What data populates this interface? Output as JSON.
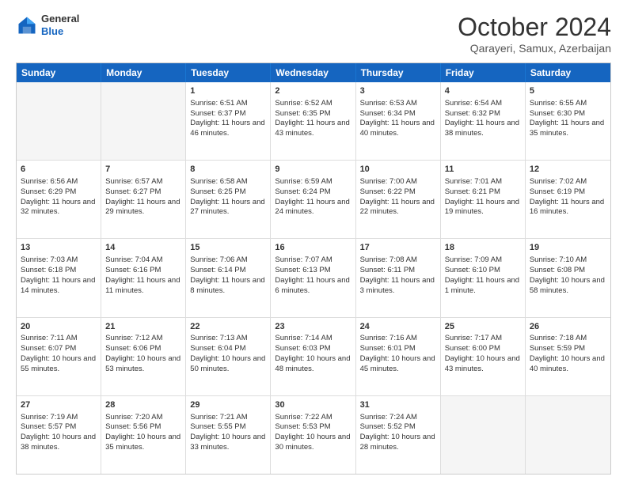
{
  "header": {
    "logo_general": "General",
    "logo_blue": "Blue",
    "month_title": "October 2024",
    "subtitle": "Qarayeri, Samux, Azerbaijan"
  },
  "weekdays": [
    "Sunday",
    "Monday",
    "Tuesday",
    "Wednesday",
    "Thursday",
    "Friday",
    "Saturday"
  ],
  "rows": [
    [
      {
        "day": "",
        "empty": true
      },
      {
        "day": "",
        "empty": true
      },
      {
        "day": "1",
        "sunrise": "Sunrise: 6:51 AM",
        "sunset": "Sunset: 6:37 PM",
        "daylight": "Daylight: 11 hours and 46 minutes."
      },
      {
        "day": "2",
        "sunrise": "Sunrise: 6:52 AM",
        "sunset": "Sunset: 6:35 PM",
        "daylight": "Daylight: 11 hours and 43 minutes."
      },
      {
        "day": "3",
        "sunrise": "Sunrise: 6:53 AM",
        "sunset": "Sunset: 6:34 PM",
        "daylight": "Daylight: 11 hours and 40 minutes."
      },
      {
        "day": "4",
        "sunrise": "Sunrise: 6:54 AM",
        "sunset": "Sunset: 6:32 PM",
        "daylight": "Daylight: 11 hours and 38 minutes."
      },
      {
        "day": "5",
        "sunrise": "Sunrise: 6:55 AM",
        "sunset": "Sunset: 6:30 PM",
        "daylight": "Daylight: 11 hours and 35 minutes."
      }
    ],
    [
      {
        "day": "6",
        "sunrise": "Sunrise: 6:56 AM",
        "sunset": "Sunset: 6:29 PM",
        "daylight": "Daylight: 11 hours and 32 minutes."
      },
      {
        "day": "7",
        "sunrise": "Sunrise: 6:57 AM",
        "sunset": "Sunset: 6:27 PM",
        "daylight": "Daylight: 11 hours and 29 minutes."
      },
      {
        "day": "8",
        "sunrise": "Sunrise: 6:58 AM",
        "sunset": "Sunset: 6:25 PM",
        "daylight": "Daylight: 11 hours and 27 minutes."
      },
      {
        "day": "9",
        "sunrise": "Sunrise: 6:59 AM",
        "sunset": "Sunset: 6:24 PM",
        "daylight": "Daylight: 11 hours and 24 minutes."
      },
      {
        "day": "10",
        "sunrise": "Sunrise: 7:00 AM",
        "sunset": "Sunset: 6:22 PM",
        "daylight": "Daylight: 11 hours and 22 minutes."
      },
      {
        "day": "11",
        "sunrise": "Sunrise: 7:01 AM",
        "sunset": "Sunset: 6:21 PM",
        "daylight": "Daylight: 11 hours and 19 minutes."
      },
      {
        "day": "12",
        "sunrise": "Sunrise: 7:02 AM",
        "sunset": "Sunset: 6:19 PM",
        "daylight": "Daylight: 11 hours and 16 minutes."
      }
    ],
    [
      {
        "day": "13",
        "sunrise": "Sunrise: 7:03 AM",
        "sunset": "Sunset: 6:18 PM",
        "daylight": "Daylight: 11 hours and 14 minutes."
      },
      {
        "day": "14",
        "sunrise": "Sunrise: 7:04 AM",
        "sunset": "Sunset: 6:16 PM",
        "daylight": "Daylight: 11 hours and 11 minutes."
      },
      {
        "day": "15",
        "sunrise": "Sunrise: 7:06 AM",
        "sunset": "Sunset: 6:14 PM",
        "daylight": "Daylight: 11 hours and 8 minutes."
      },
      {
        "day": "16",
        "sunrise": "Sunrise: 7:07 AM",
        "sunset": "Sunset: 6:13 PM",
        "daylight": "Daylight: 11 hours and 6 minutes."
      },
      {
        "day": "17",
        "sunrise": "Sunrise: 7:08 AM",
        "sunset": "Sunset: 6:11 PM",
        "daylight": "Daylight: 11 hours and 3 minutes."
      },
      {
        "day": "18",
        "sunrise": "Sunrise: 7:09 AM",
        "sunset": "Sunset: 6:10 PM",
        "daylight": "Daylight: 11 hours and 1 minute."
      },
      {
        "day": "19",
        "sunrise": "Sunrise: 7:10 AM",
        "sunset": "Sunset: 6:08 PM",
        "daylight": "Daylight: 10 hours and 58 minutes."
      }
    ],
    [
      {
        "day": "20",
        "sunrise": "Sunrise: 7:11 AM",
        "sunset": "Sunset: 6:07 PM",
        "daylight": "Daylight: 10 hours and 55 minutes."
      },
      {
        "day": "21",
        "sunrise": "Sunrise: 7:12 AM",
        "sunset": "Sunset: 6:06 PM",
        "daylight": "Daylight: 10 hours and 53 minutes."
      },
      {
        "day": "22",
        "sunrise": "Sunrise: 7:13 AM",
        "sunset": "Sunset: 6:04 PM",
        "daylight": "Daylight: 10 hours and 50 minutes."
      },
      {
        "day": "23",
        "sunrise": "Sunrise: 7:14 AM",
        "sunset": "Sunset: 6:03 PM",
        "daylight": "Daylight: 10 hours and 48 minutes."
      },
      {
        "day": "24",
        "sunrise": "Sunrise: 7:16 AM",
        "sunset": "Sunset: 6:01 PM",
        "daylight": "Daylight: 10 hours and 45 minutes."
      },
      {
        "day": "25",
        "sunrise": "Sunrise: 7:17 AM",
        "sunset": "Sunset: 6:00 PM",
        "daylight": "Daylight: 10 hours and 43 minutes."
      },
      {
        "day": "26",
        "sunrise": "Sunrise: 7:18 AM",
        "sunset": "Sunset: 5:59 PM",
        "daylight": "Daylight: 10 hours and 40 minutes."
      }
    ],
    [
      {
        "day": "27",
        "sunrise": "Sunrise: 7:19 AM",
        "sunset": "Sunset: 5:57 PM",
        "daylight": "Daylight: 10 hours and 38 minutes."
      },
      {
        "day": "28",
        "sunrise": "Sunrise: 7:20 AM",
        "sunset": "Sunset: 5:56 PM",
        "daylight": "Daylight: 10 hours and 35 minutes."
      },
      {
        "day": "29",
        "sunrise": "Sunrise: 7:21 AM",
        "sunset": "Sunset: 5:55 PM",
        "daylight": "Daylight: 10 hours and 33 minutes."
      },
      {
        "day": "30",
        "sunrise": "Sunrise: 7:22 AM",
        "sunset": "Sunset: 5:53 PM",
        "daylight": "Daylight: 10 hours and 30 minutes."
      },
      {
        "day": "31",
        "sunrise": "Sunrise: 7:24 AM",
        "sunset": "Sunset: 5:52 PM",
        "daylight": "Daylight: 10 hours and 28 minutes."
      },
      {
        "day": "",
        "empty": true
      },
      {
        "day": "",
        "empty": true
      }
    ]
  ]
}
